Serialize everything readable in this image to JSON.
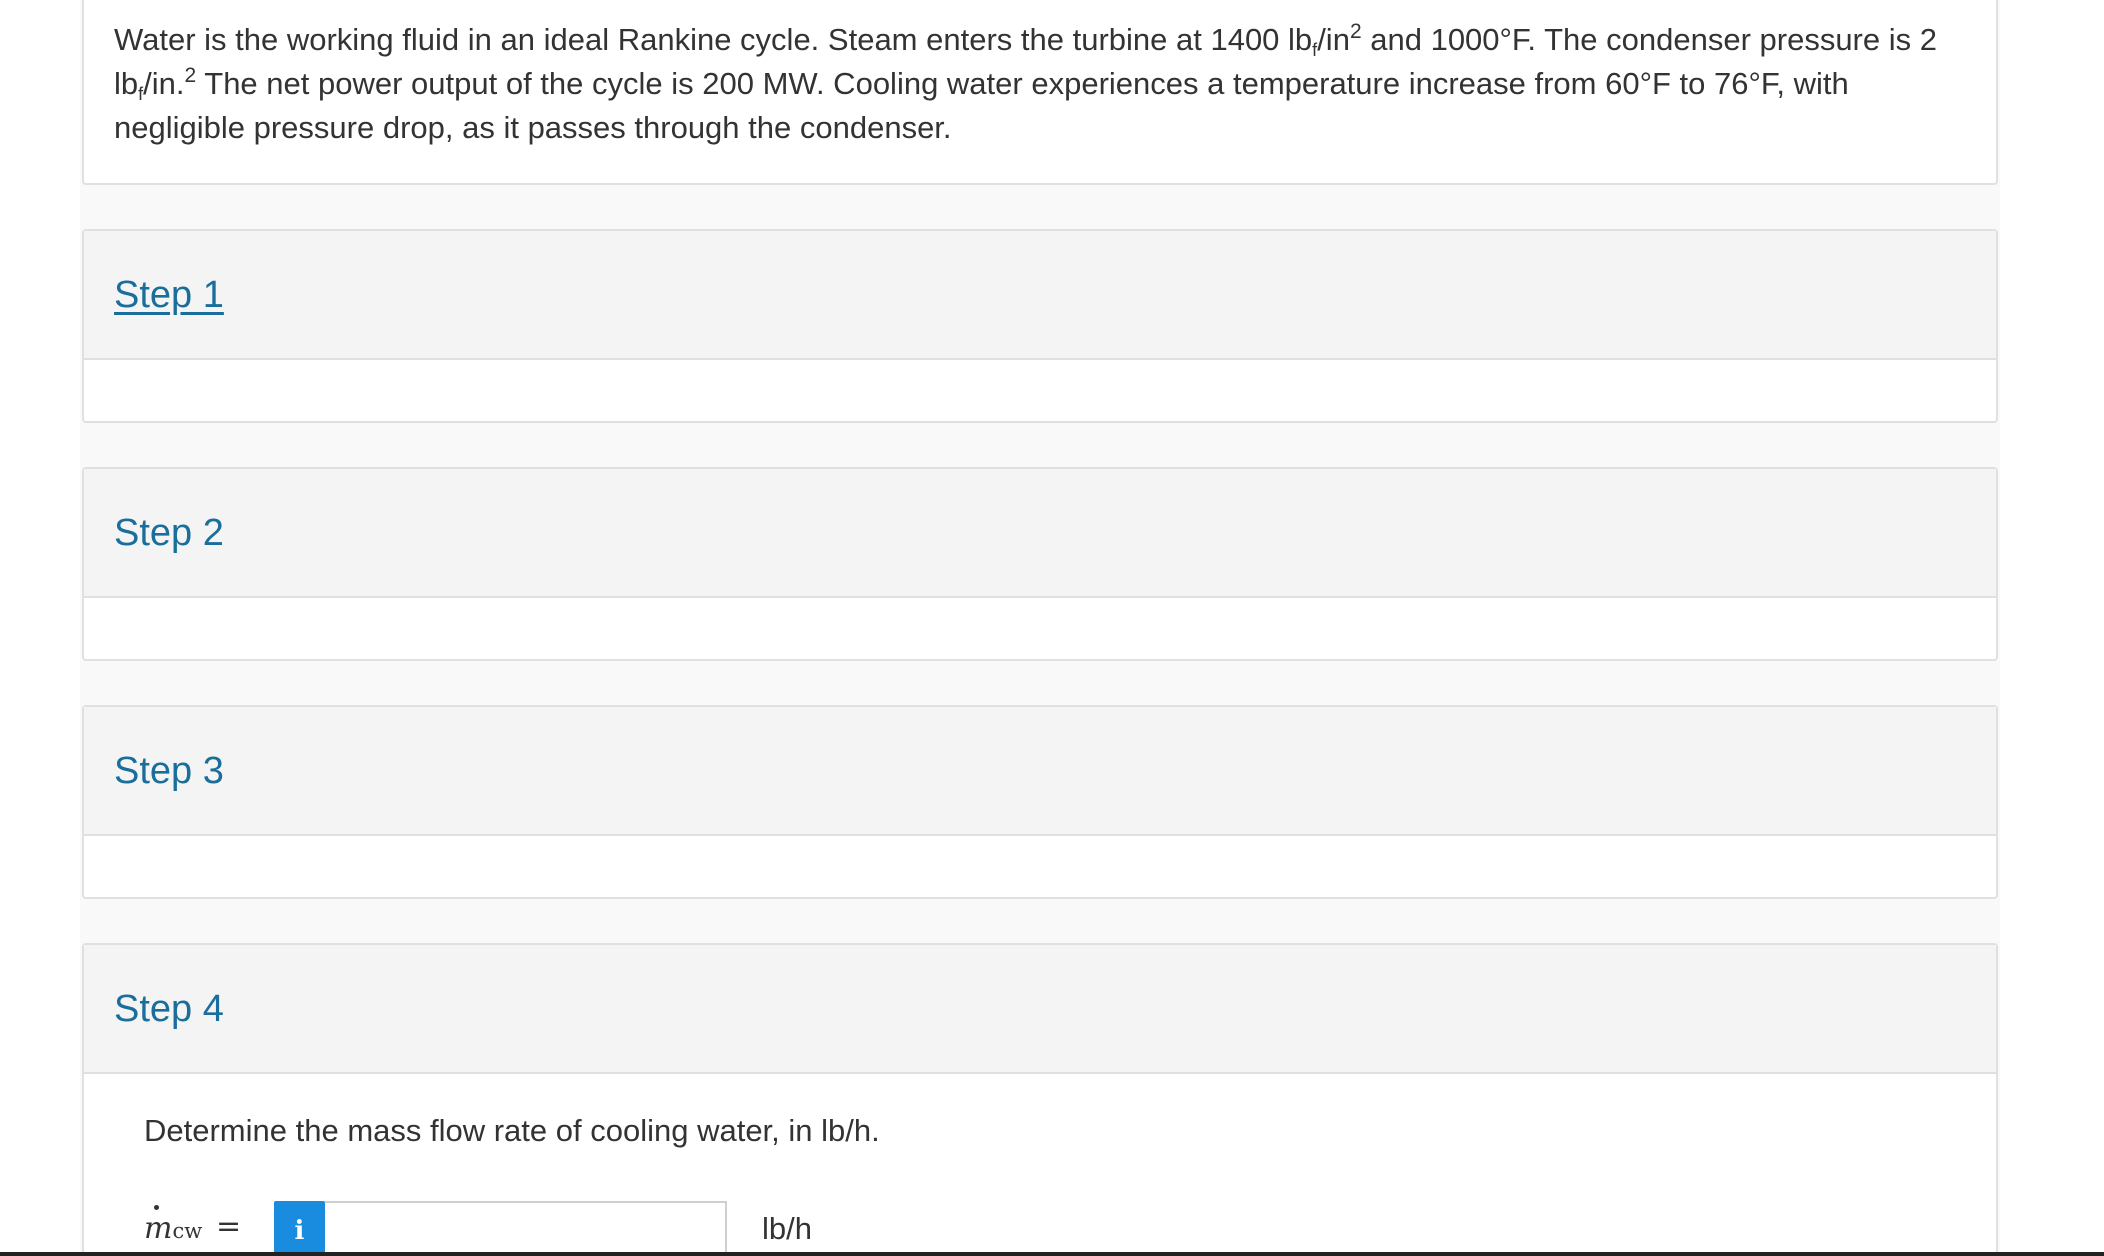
{
  "problem": {
    "part1": "Water is the working fluid in an ideal Rankine cycle. Steam enters the turbine at 1400 lb",
    "sub1": "f",
    "part2": "/in",
    "sup1": "2",
    "part3": " and 1000°F. The condenser pressure is 2 lb",
    "sub2": "f",
    "part4": "/in.",
    "sup2": "2",
    "part5": " The net power output of the cycle is 200 MW. Cooling water experiences a temperature increase from 60°F to 76°F, with negligible pressure drop, as it passes through the condenser."
  },
  "steps": [
    {
      "label": "Step 1"
    },
    {
      "label": "Step 2"
    },
    {
      "label": "Step 3"
    },
    {
      "label": "Step 4"
    }
  ],
  "question": "Determine the mass flow rate of cooling water, in lb/h.",
  "answer": {
    "variable": "m",
    "variable_sub": "cw",
    "equals": "=",
    "info_label": "i",
    "value": "",
    "unit": "lb/h"
  },
  "colors": {
    "link": "#1a6e9c",
    "info_button": "#1a8ce0",
    "step_header_bg": "#f4f4f4"
  }
}
